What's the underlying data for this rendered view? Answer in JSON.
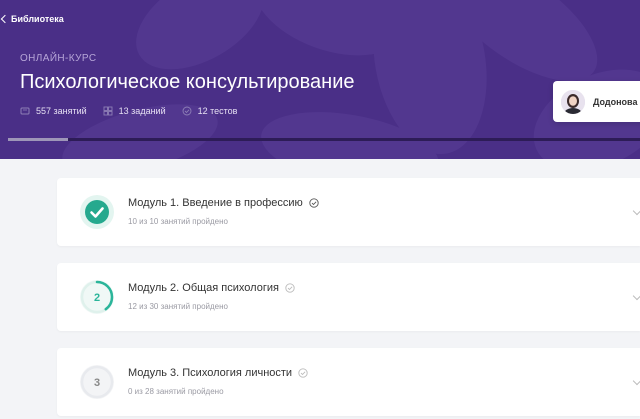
{
  "nav": {
    "back_label": "Библиотека"
  },
  "course": {
    "kicker": "ОНЛАЙН-КУРС",
    "title": "Психологическое консультирование",
    "stats": [
      {
        "icon": "lessons-icon",
        "label": "557 занятий"
      },
      {
        "icon": "tasks-icon",
        "label": "13 заданий"
      },
      {
        "icon": "tests-icon",
        "label": "12 тестов"
      }
    ],
    "progress_fraction": 0.095
  },
  "user": {
    "name": "Додонова К"
  },
  "colors": {
    "hero": "#4a2f87",
    "accent": "#2bb59a",
    "complete": "#25a98e"
  },
  "modules": [
    {
      "number": "1",
      "title": "Модуль 1. Введение в профессию",
      "subtitle": "10 из 10 занятий пройдено",
      "done": 10,
      "total": 10,
      "completed": true
    },
    {
      "number": "2",
      "title": "Модуль 2. Общая психология",
      "subtitle": "12 из 30 занятий пройдено",
      "done": 12,
      "total": 30,
      "completed": false
    },
    {
      "number": "3",
      "title": "Модуль 3. Психология личности",
      "subtitle": "0 из 28 занятий пройдено",
      "done": 0,
      "total": 28,
      "completed": false
    }
  ]
}
